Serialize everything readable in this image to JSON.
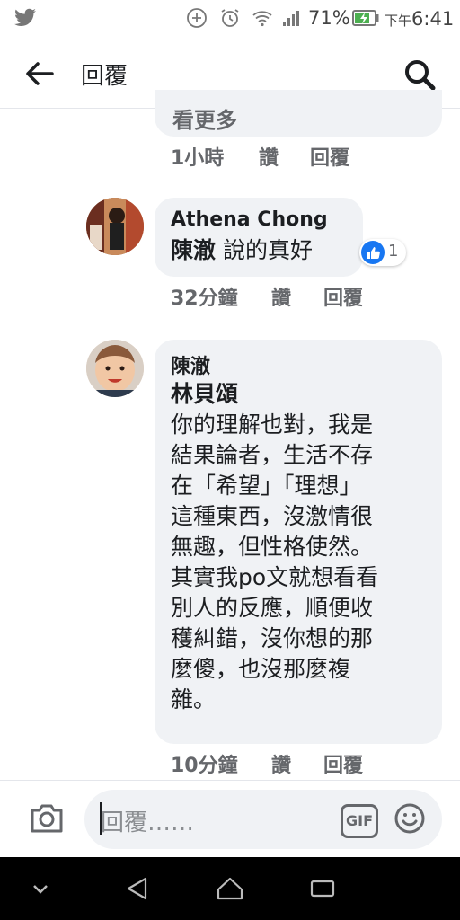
{
  "status_bar": {
    "battery_percent": "71%",
    "time_prefix": "下午",
    "time": "6:41"
  },
  "header": {
    "title": "回覆"
  },
  "prev_comment": {
    "partial_text": "看更多",
    "time": "1小時",
    "like": "讚",
    "reply": "回覆"
  },
  "comment1": {
    "author": "Athena Chong",
    "mention": "陳澈",
    "text": " 說的真好",
    "reaction_count": "1",
    "time": "32分鐘",
    "like": "讚",
    "reply": "回覆"
  },
  "comment2": {
    "author": "陳澈",
    "mention": "林貝頌",
    "lines": [
      "你的理解也對，我是",
      "結果論者，生活不存",
      "在「希望」「理想」",
      "這種東西，沒激情很",
      "無趣，但性格使然。",
      "其實我po文就想看看",
      "別人的反應，順便收",
      "穫糾錯，沒你想的那",
      "麼傻，也沒那麼複",
      "雜。"
    ],
    "time": "10分鐘",
    "like": "讚",
    "reply": "回覆"
  },
  "composer": {
    "placeholder": "回覆……",
    "gif_label": "GIF"
  }
}
